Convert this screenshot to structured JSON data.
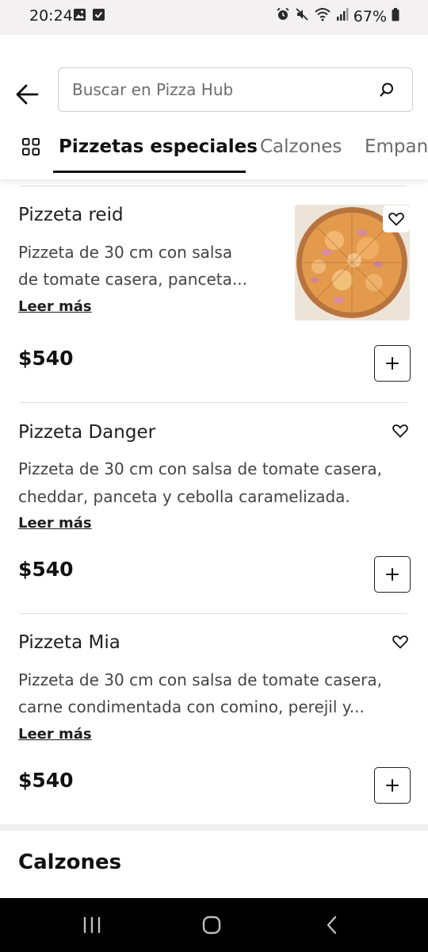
{
  "status_bar": {
    "time": "20:24",
    "battery": "67%",
    "icons_left": [
      "image-icon",
      "check-box-icon"
    ],
    "icons_right": [
      "alarm-icon",
      "mute-icon",
      "wifi-icon",
      "signal-icon",
      "battery-icon"
    ]
  },
  "header": {
    "search_placeholder": "Buscar en Pizza Hub"
  },
  "tabs": [
    {
      "label": "Pizzetas especiales",
      "active": true
    },
    {
      "label": "Calzones",
      "active": false
    },
    {
      "label": "Empanadas",
      "active": false
    }
  ],
  "items": [
    {
      "title": "Pizzeta reid",
      "desc_line1": "Pizzeta de 30 cm con salsa",
      "desc_line2": "de tomate casera, panceta...",
      "read_more": "Leer más",
      "price": "$540"
    },
    {
      "title": "Pizzeta Danger",
      "desc_line1": "Pizzeta de 30 cm con salsa de tomate casera,",
      "desc_line2": "cheddar, panceta y cebolla caramelizada.",
      "read_more": "Leer más",
      "price": "$540"
    },
    {
      "title": "Pizzeta Mia",
      "desc_line1": "Pizzeta de 30 cm con salsa de tomate casera,",
      "desc_line2": "carne condimentada con comino, perejil y...",
      "read_more": "Leer más",
      "price": "$540"
    }
  ],
  "next_section": {
    "title": "Calzones"
  },
  "colors": {
    "text_primary": "#1f1f1f",
    "text_secondary": "#444444",
    "divider": "#dedede",
    "nav_background": "#000000",
    "status_background": "#f3f1f2"
  }
}
